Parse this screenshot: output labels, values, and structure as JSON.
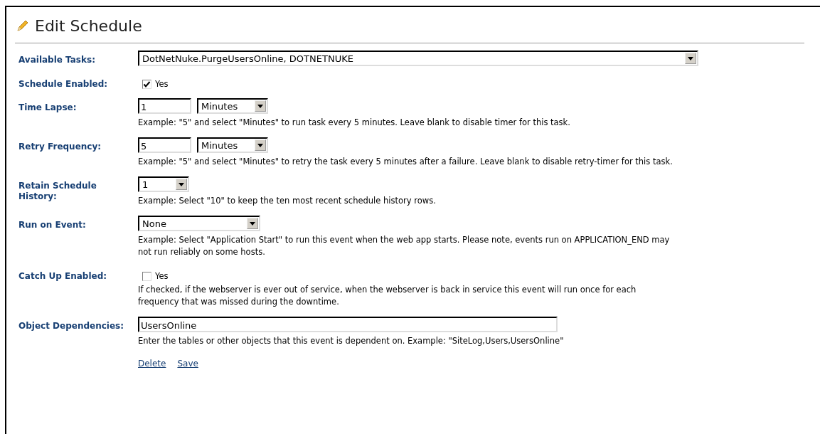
{
  "title": "Edit Schedule",
  "fields": [
    {
      "label": "Available Tasks:",
      "kind": "select",
      "value": "DotNetNuke.PurgeUsersOnline, DOTNETNUKE"
    },
    {
      "label": "Schedule Enabled:",
      "kind": "checkbox",
      "checked": true,
      "option": "Yes"
    },
    {
      "label": "Time Lapse:",
      "kind": "number_unit",
      "value": "1",
      "unit": "Minutes",
      "help": [
        "Example: \"5\" and select \"Minutes\" to run task every 5 minutes. Leave blank to disable timer for this task."
      ]
    },
    {
      "label": "Retry Frequency:",
      "kind": "number_unit",
      "value": "5",
      "unit": "Minutes",
      "help": [
        "Example: \"5\" and select \"Minutes\" to retry the task every 5 minutes after a failure. Leave blank to disable retry-timer for this task."
      ]
    },
    {
      "label": "Retain Schedule History:",
      "kind": "select",
      "value": "1",
      "help": [
        "Example: Select \"10\" to keep the ten most recent schedule history rows."
      ]
    },
    {
      "label": "Run on Event:",
      "kind": "select",
      "value": "None",
      "help": [
        "Example: Select \"Application Start\" to run this event when the web app starts. Please note, events run on APPLICATION_END may",
        "not run reliably on some hosts."
      ]
    },
    {
      "label": "Catch Up Enabled:",
      "kind": "checkbox",
      "checked": false,
      "option": "Yes",
      "help": [
        "If checked, if the webserver is ever out of service, when the webserver is back in service this event will run once for each",
        "frequency that was missed during the downtime."
      ]
    },
    {
      "label": "Object Dependencies:",
      "kind": "text",
      "value": "UsersOnline",
      "help": [
        "Enter the tables or other objects that this event is dependent on. Example: \"SiteLog,Users,UsersOnline\""
      ]
    }
  ],
  "links": [
    "Delete",
    "Save"
  ]
}
